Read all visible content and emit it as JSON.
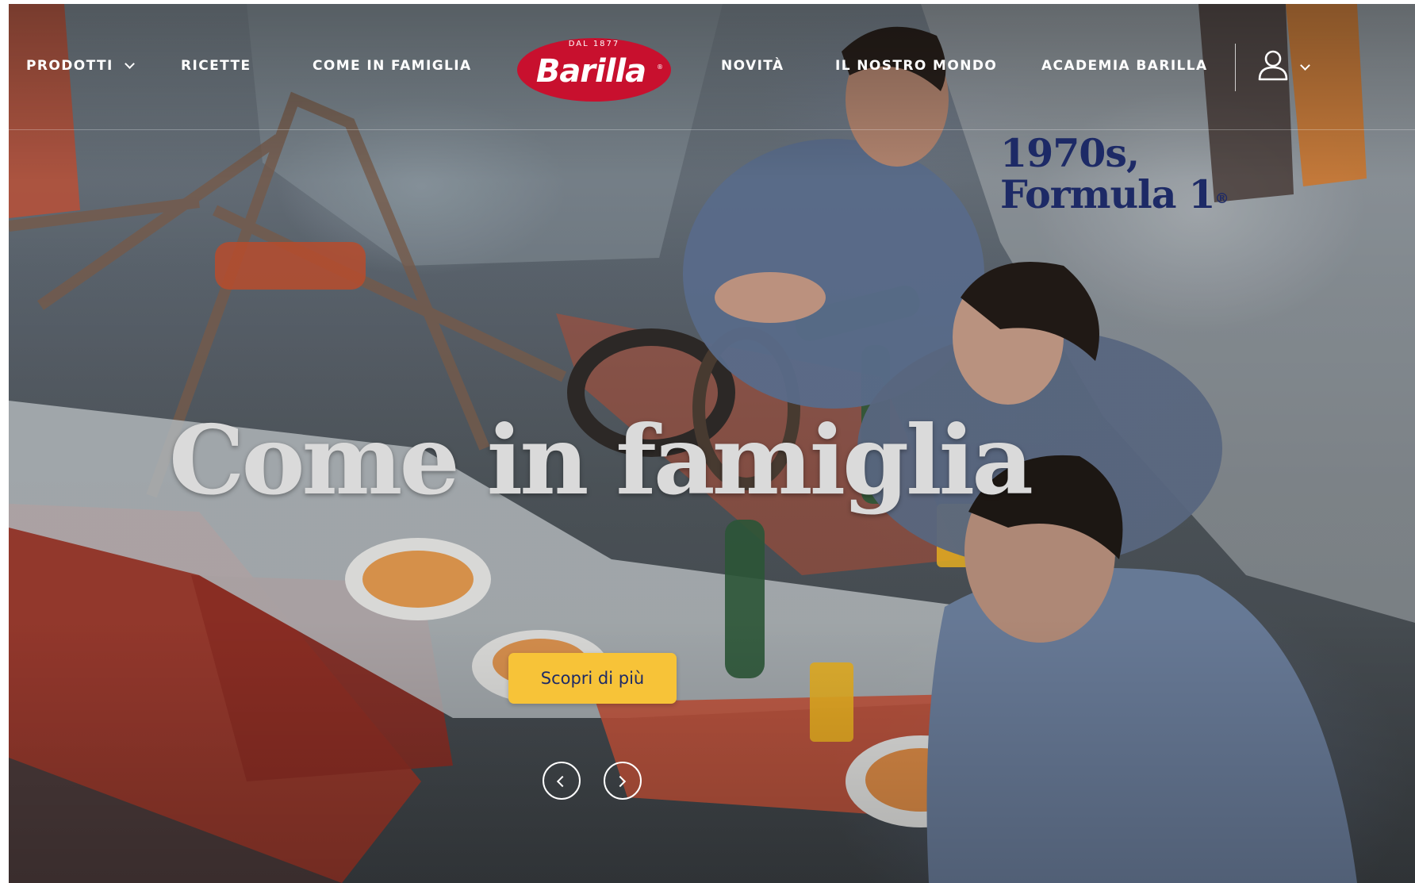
{
  "nav": {
    "items": [
      {
        "label": "PRODOTTI",
        "has_dropdown": true
      },
      {
        "label": "RICETTE",
        "has_dropdown": false
      },
      {
        "label": "COME IN FAMIGLIA",
        "has_dropdown": false
      },
      {
        "label": "NOVITÀ",
        "has_dropdown": false
      },
      {
        "label": "IL NOSTRO MONDO",
        "has_dropdown": false
      },
      {
        "label": "ACADEMIA BARILLA",
        "has_dropdown": false
      }
    ],
    "logo": {
      "brand": "Barilla",
      "tagline": "DAL 1877",
      "registered": "®"
    },
    "user_icon": "user-icon",
    "user_dropdown_icon": "chevron-down-icon"
  },
  "hero": {
    "badge_line1": "1970s,",
    "badge_line2": "Formula 1",
    "badge_mark": "®",
    "headline": "Come in famiglia",
    "cta_label": "Scopri di più",
    "prev_icon": "chevron-left-icon",
    "next_icon": "chevron-right-icon"
  },
  "colors": {
    "logo_red": "#c8102e",
    "badge_blue": "#1d2a66",
    "cta_yellow": "#f7c338",
    "cta_text": "#1d2a66"
  }
}
